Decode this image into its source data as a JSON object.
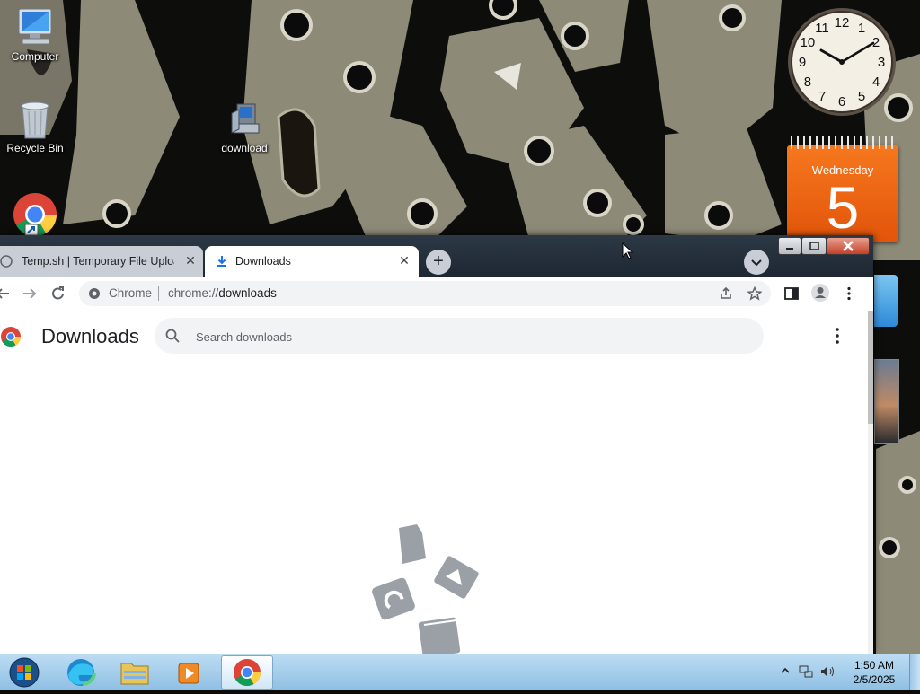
{
  "desktop": {
    "icons": [
      {
        "label": "Computer"
      },
      {
        "label": "Recycle Bin"
      },
      {
        "label": "download"
      },
      {
        "label": ""
      }
    ]
  },
  "gadgets": {
    "calendar": {
      "weekday": "Wednesday",
      "day": "5"
    },
    "clock": {
      "numerals": [
        "12",
        "1",
        "2",
        "3",
        "4",
        "5",
        "6",
        "7",
        "8",
        "9",
        "10",
        "11"
      ]
    }
  },
  "browser": {
    "tabs": [
      {
        "label": "Temp.sh | Temporary File Upload",
        "active": false
      },
      {
        "label": "Downloads",
        "active": true
      }
    ],
    "new_tab_label": "+",
    "omnibox": {
      "site_chip": "Chrome",
      "url_scheme": "chrome://",
      "url_host": "downloads"
    },
    "page": {
      "title": "Downloads",
      "search_placeholder": "Search downloads"
    }
  },
  "taskbar": {
    "time": "1:50 AM",
    "date": "2/5/2025",
    "apps": [
      "start-orb",
      "edge",
      "explorer",
      "media-player",
      "chrome"
    ]
  },
  "colors": {
    "calendar_orange": "#f26b16",
    "taskbar_blue": "#a7cdea",
    "chrome_tab_strip": "#253140",
    "empty_state_gray": "#9aa0a6"
  }
}
